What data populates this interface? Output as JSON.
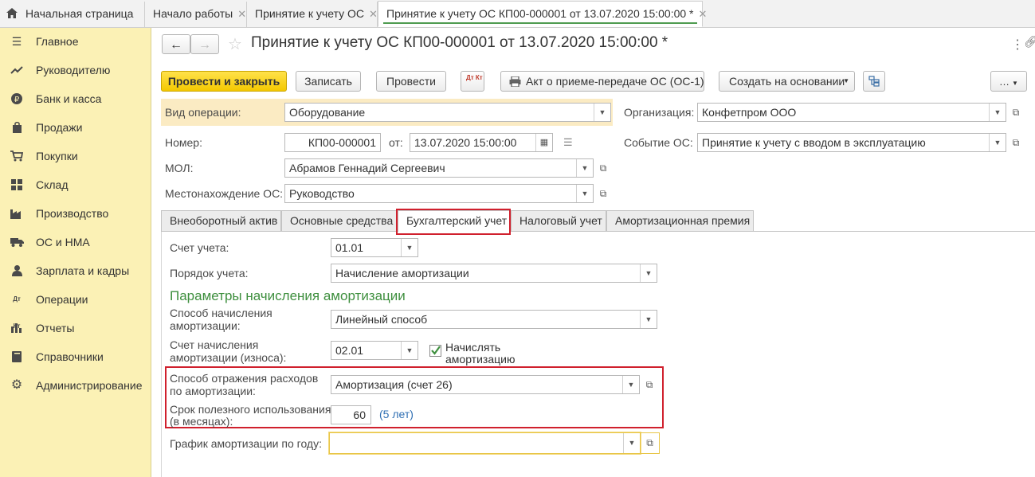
{
  "tabs": {
    "home": "Начальная страница",
    "items": [
      {
        "label": "Начало работы"
      },
      {
        "label": "Принятие к учету ОС"
      },
      {
        "label": "Принятие к учету ОС КП00-000001 от 13.07.2020 15:00:00 *"
      }
    ]
  },
  "sidebar": {
    "items": [
      {
        "label": "Главное",
        "icon": "menu-icon"
      },
      {
        "label": "Руководителю",
        "icon": "chart-line-icon"
      },
      {
        "label": "Банк и касса",
        "icon": "ruble-icon"
      },
      {
        "label": "Продажи",
        "icon": "bag-icon"
      },
      {
        "label": "Покупки",
        "icon": "cart-icon"
      },
      {
        "label": "Склад",
        "icon": "grid-icon"
      },
      {
        "label": "Производство",
        "icon": "factory-icon"
      },
      {
        "label": "ОС и НМА",
        "icon": "truck-icon"
      },
      {
        "label": "Зарплата и кадры",
        "icon": "person-icon"
      },
      {
        "label": "Операции",
        "icon": "dt-kt-icon"
      },
      {
        "label": "Отчеты",
        "icon": "bar-chart-icon"
      },
      {
        "label": "Справочники",
        "icon": "book-icon"
      },
      {
        "label": "Администрирование",
        "icon": "gear-icon"
      }
    ],
    "dtkt_glyph": "Дт Кт"
  },
  "document": {
    "title": "Принятие к учету ОС КП00-000001 от 13.07.2020 15:00:00 *"
  },
  "toolbar": {
    "post_close": "Провести и закрыть",
    "save": "Записать",
    "post": "Провести",
    "dtkt": "Дт Кт",
    "act": "Акт о приеме-передаче ОС (ОС-1)",
    "create_based": "Создать на основании"
  },
  "header": {
    "op_type_label": "Вид операции:",
    "op_type_value": "Оборудование",
    "org_label": "Организация:",
    "org_value": "Конфетпром ООО",
    "number_label": "Номер:",
    "number_value": "КП00-000001",
    "date_label": "от:",
    "date_value": "13.07.2020 15:00:00",
    "event_label": "Событие ОС:",
    "event_value": "Принятие к учету с вводом в эксплуатацию",
    "mol_label": "МОЛ:",
    "mol_value": "Абрамов Геннадий Сергеевич",
    "location_label": "Местонахождение ОС:",
    "location_value": "Руководство"
  },
  "section_tabs": [
    {
      "label": "Внеоборотный актив"
    },
    {
      "label": "Основные средства"
    },
    {
      "label": "Бухгалтерский учет"
    },
    {
      "label": "Налоговый учет"
    },
    {
      "label": "Амортизационная премия"
    }
  ],
  "accounting": {
    "account_label": "Счет учета:",
    "account_value": "01.01",
    "procedure_label": "Порядок учета:",
    "procedure_value": "Начисление амортизации",
    "params_heading": "Параметры начисления амортизации",
    "method_label_1": "Способ начисления",
    "method_label_2": "амортизации:",
    "method_value": "Линейный способ",
    "depr_account_label_1": "Счет начисления",
    "depr_account_label_2": "амортизации (износа):",
    "depr_account_value": "02.01",
    "accrue_label_1": "Начислять",
    "accrue_label_2": "амортизацию",
    "accrue_checked": true,
    "expense_label_1": "Способ отражения расходов",
    "expense_label_2": "по амортизации:",
    "expense_value": "Амортизация (счет 26)",
    "life_label_1": "Срок полезного использования",
    "life_label_2": "(в месяцах):",
    "life_value": "60",
    "life_years": "(5 лет)",
    "schedule_label": "График амортизации по году:",
    "schedule_value": ""
  },
  "colors": {
    "sidebar_bg": "#fbf1b5",
    "primary_button": "#f4c800",
    "heading_green": "#3e8f3e",
    "highlight_red": "#d0202d",
    "link_blue": "#2f6fb3"
  }
}
